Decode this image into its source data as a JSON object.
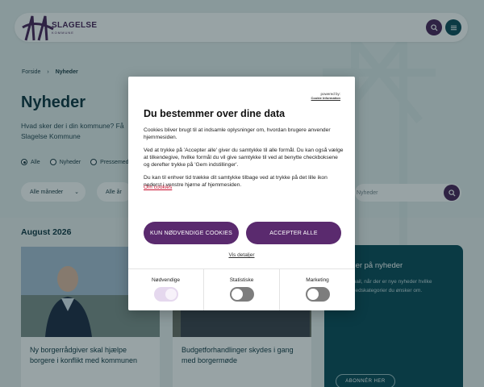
{
  "header": {
    "logo_text": "SLAGELSE",
    "logo_subtext": "KOMMUNE"
  },
  "breadcrumb": {
    "home": "Forside",
    "current": "Nyheder"
  },
  "page": {
    "title": "Nyheder",
    "intro": "Hvad sker der i din kommune? Få Slagelse Kommune"
  },
  "filters": {
    "radios": [
      {
        "label": "Alle",
        "selected": true
      },
      {
        "label": "Nyheder",
        "selected": false
      },
      {
        "label": "Pressemed",
        "selected": false
      }
    ],
    "months_select": "Alle måneder",
    "year_select": "Alle år",
    "search_placeholder": "Nyheder"
  },
  "month_heading": "August 2026",
  "cards": [
    {
      "title": "Ny borgerrådgiver skal hjælpe borgere i konflikt med kommunen"
    },
    {
      "title": "Budgetforhandlinger skydes i gang med borgermøde"
    }
  ],
  "subscribe": {
    "title": "nner på nyheder",
    "text": "e-mail, når der er nye nyheder hvilke nyhedskategorier du ønsker om.",
    "button": "ABONNÉR HER"
  },
  "dialog": {
    "powered_by": "powered by:",
    "powered_brand": "Cookie Information",
    "title": "Du bestemmer over dine data",
    "paragraphs": [
      "Cookies bliver brugt til at indsamle oplysninger om, hvordan brugere anvender hjemmesiden.",
      "Ved at trykke på 'Accepter alle' giver du samtykke til alle formål. Du kan også vælge at tilkendegive, hvilke formål du vil give samtykke til ved at benytte checkboksene og derefter trykke på 'Gem indstillinger'.",
      "Du kan til enhver tid trække dit samtykke tilbage ved at trykke på det lille ikon nederst i venstre hjørne af hjemmesiden."
    ],
    "about_link": "Om cookies",
    "btn_necessary": "KUN NØDVENDIGE COOKIES",
    "btn_accept": "ACCEPTER ALLE",
    "details_link": "Vis detaljer",
    "toggles": [
      {
        "label": "Nødvendige",
        "on": true
      },
      {
        "label": "Statistiske",
        "on": false
      },
      {
        "label": "Marketing",
        "on": false
      }
    ]
  },
  "colors": {
    "brand_purple": "#5a2a6e",
    "teal": "#0b4a58",
    "link_red": "#c8102e"
  }
}
